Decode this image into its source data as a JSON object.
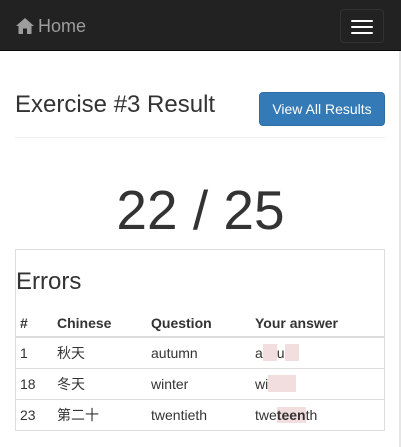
{
  "navbar": {
    "brand_label": "Home",
    "brand_icon": "home-icon",
    "menu_icon": "hamburger-menu-icon",
    "background": "#222222"
  },
  "page": {
    "title": "Exercise #3 Result",
    "view_all_label": "View All Results",
    "accent": "#337ab7"
  },
  "score": {
    "text": "22 / 25",
    "correct": 22,
    "total": 25
  },
  "errors": {
    "title": "Errors",
    "columns": [
      "#",
      "Chinese",
      "Question",
      "Your answer"
    ],
    "rows": [
      {
        "num": "1",
        "chinese": "秋天",
        "question": "autumn",
        "answer": [
          {
            "text": "a",
            "mark": false
          },
          {
            "text": "",
            "mark": true
          },
          {
            "text": "u",
            "mark": false
          },
          {
            "text": "",
            "mark": true
          }
        ]
      },
      {
        "num": "18",
        "chinese": "冬天",
        "question": "winter",
        "answer": [
          {
            "text": "wi",
            "mark": false
          },
          {
            "text": "",
            "mark": true
          },
          {
            "text": "",
            "mark": true
          }
        ]
      },
      {
        "num": "23",
        "chinese": "第二十",
        "question": "twentieth",
        "answer": [
          {
            "text": "twe",
            "mark": false
          },
          {
            "text": "teen",
            "mark": true
          },
          {
            "text": "th",
            "mark": false
          }
        ]
      }
    ],
    "highlight_color": "#f2dede"
  }
}
